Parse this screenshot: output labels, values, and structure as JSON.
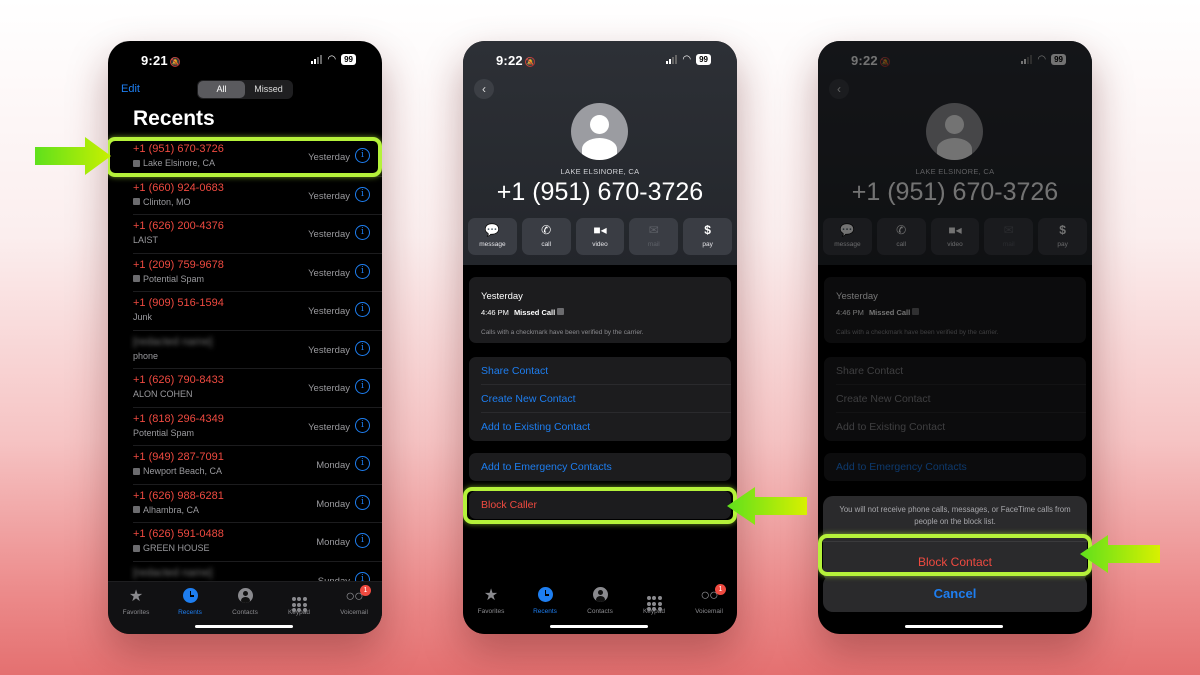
{
  "status_bar": {
    "phone1_time": "9:21",
    "phone2_time": "9:22",
    "phone3_time": "9:22",
    "battery": "99"
  },
  "recents": {
    "edit_label": "Edit",
    "filter_tabs": [
      {
        "label": "All",
        "active": true
      },
      {
        "label": "Missed",
        "active": false
      }
    ],
    "title": "Recents",
    "calls": [
      {
        "number": "+1 (951) 670-3726",
        "subtitle": "Lake Elsinore, CA",
        "verified": true,
        "when": "Yesterday",
        "highlighted": true
      },
      {
        "number": "+1 (660) 924-0683",
        "subtitle": "Clinton, MO",
        "verified": true,
        "when": "Yesterday"
      },
      {
        "number": "+1 (626) 200-4376",
        "subtitle": "LAIST",
        "verified": false,
        "when": "Yesterday"
      },
      {
        "number": "+1 (209) 759-9678",
        "subtitle": "Potential Spam",
        "verified": true,
        "when": "Yesterday"
      },
      {
        "number": "+1 (909) 516-1594",
        "subtitle": "Junk",
        "verified": false,
        "when": "Yesterday"
      },
      {
        "number": "[redacted name]",
        "subtitle": "phone",
        "verified": false,
        "when": "Yesterday",
        "redacted": true
      },
      {
        "number": "+1 (626) 790-8433",
        "subtitle": "ALON COHEN",
        "verified": false,
        "when": "Yesterday"
      },
      {
        "number": "+1 (818) 296-4349",
        "subtitle": "Potential Spam",
        "verified": false,
        "when": "Yesterday"
      },
      {
        "number": "+1 (949) 287-7091",
        "subtitle": "Newport Beach, CA",
        "verified": true,
        "when": "Monday"
      },
      {
        "number": "+1 (626) 988-6281",
        "subtitle": "Alhambra, CA",
        "verified": true,
        "when": "Monday"
      },
      {
        "number": "+1 (626) 591-0488",
        "subtitle": "GREEN HOUSE",
        "verified": true,
        "when": "Monday"
      },
      {
        "number": "[redacted name]",
        "subtitle": "",
        "verified": false,
        "when": "Sunday",
        "redacted": true
      }
    ]
  },
  "tabbar": {
    "tabs": [
      {
        "label": "Favorites",
        "icon": "star-icon"
      },
      {
        "label": "Recents",
        "icon": "clock-icon",
        "active": true
      },
      {
        "label": "Contacts",
        "icon": "person-circle-icon"
      },
      {
        "label": "Keypad",
        "icon": "keypad-icon"
      },
      {
        "label": "Voicemail",
        "icon": "voicemail-icon",
        "badge": "1"
      }
    ]
  },
  "detail": {
    "location": "LAKE ELSINORE, CA",
    "number": "+1 (951) 670-3726",
    "actions": [
      {
        "label": "message",
        "icon": "message-bubble-icon",
        "enabled": true
      },
      {
        "label": "call",
        "icon": "phone-icon",
        "enabled": true
      },
      {
        "label": "video",
        "icon": "video-camera-icon",
        "enabled": true
      },
      {
        "label": "mail",
        "icon": "envelope-icon",
        "enabled": false
      },
      {
        "label": "pay",
        "icon": "dollar-icon",
        "enabled": true
      }
    ],
    "history": {
      "day": "Yesterday",
      "time": "4:46 PM",
      "type": "Missed Call",
      "note": "Calls with a checkmark have been verified by the carrier."
    },
    "contact_options": [
      "Share Contact",
      "Create New Contact",
      "Add to Existing Contact"
    ],
    "emergency_label": "Add to Emergency Contacts",
    "block_label": "Block Caller"
  },
  "block_sheet": {
    "message": "You will not receive phone calls, messages, or FaceTime calls from people on the block list.",
    "confirm_label": "Block Contact",
    "cancel_label": "Cancel"
  },
  "colors": {
    "accent_blue": "#1e7ef0",
    "missed_red": "#ef4a40",
    "highlight_green": "#b5f23a"
  }
}
